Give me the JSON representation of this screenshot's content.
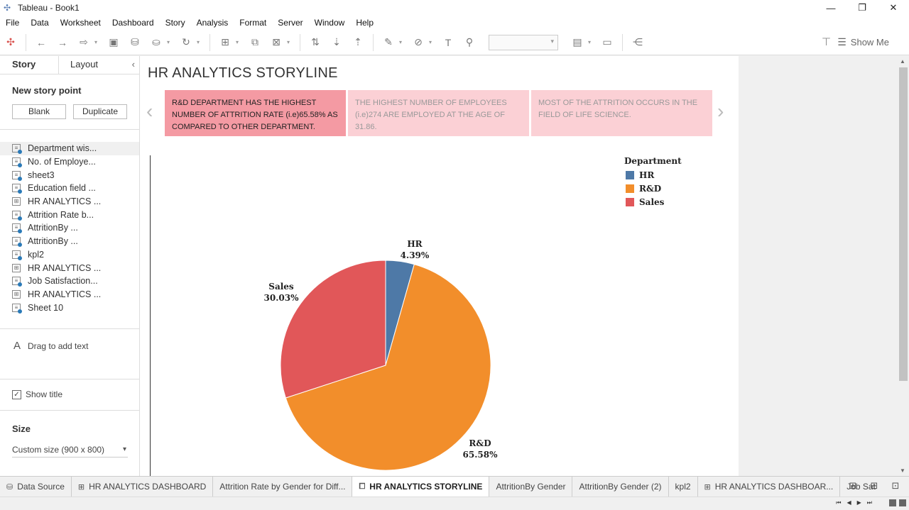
{
  "window": {
    "title": "Tableau - Book1"
  },
  "menu": [
    "File",
    "Data",
    "Worksheet",
    "Dashboard",
    "Story",
    "Analysis",
    "Format",
    "Server",
    "Window",
    "Help"
  ],
  "toolbar": {
    "show_me": "Show Me"
  },
  "sidebar": {
    "tab_story": "Story",
    "tab_layout": "Layout",
    "new_story_point": "New story point",
    "blank_label": "Blank",
    "duplicate_label": "Duplicate",
    "sheets": [
      {
        "label": "Department wis...",
        "type": "sheet"
      },
      {
        "label": "No. of Employe...",
        "type": "sheet"
      },
      {
        "label": "sheet3",
        "type": "sheet"
      },
      {
        "label": "Education field ...",
        "type": "sheet"
      },
      {
        "label": "HR ANALYTICS ...",
        "type": "dashboard"
      },
      {
        "label": "Attrition Rate b...",
        "type": "sheet"
      },
      {
        "label": "AttritionBy ...",
        "type": "sheet"
      },
      {
        "label": "AttritionBy ...",
        "type": "sheet"
      },
      {
        "label": "kpl2",
        "type": "sheet"
      },
      {
        "label": "HR ANALYTICS ...",
        "type": "dashboard"
      },
      {
        "label": "Job Satisfaction...",
        "type": "sheet"
      },
      {
        "label": "HR ANALYTICS ...",
        "type": "dashboard"
      },
      {
        "label": "Sheet 10",
        "type": "sheet"
      }
    ],
    "drag_text": "Drag to add text",
    "show_title": "Show title",
    "size_heading": "Size",
    "size_value": "Custom size (900 x 800)"
  },
  "story": {
    "title": "HR ANALYTICS STORYLINE",
    "points": [
      "R&D DEPARTMENT HAS THE HIGHEST NUMBER OF  ATTRITION RATE  (i.e)65.58% AS COMPARED TO OTHER DEPARTMENT.",
      "THE HIGHEST NUMBER OF EMPLOYEES (i.e)274 ARE EMPLOYED AT THE AGE OF 31.86.",
      "MOST OF THE ATTRITION OCCURS IN THE FIELD OF LIFE SCIENCE."
    ]
  },
  "chart_data": {
    "type": "pie",
    "legend_title": "Department",
    "legend_position": "top-right",
    "slices": [
      {
        "name": "HR",
        "value": 4.39,
        "label": "4.39%",
        "color": "#4e79a7"
      },
      {
        "name": "R&D",
        "value": 65.58,
        "label": "65.58%",
        "color": "#f28e2b"
      },
      {
        "name": "Sales",
        "value": 30.03,
        "label": "30.03%",
        "color": "#e15759"
      }
    ]
  },
  "bottom_tabs": [
    {
      "label": "Data Source",
      "icon": "database-icon",
      "active": false
    },
    {
      "label": "HR ANALYTICS DASHBOARD",
      "icon": "dashboard-icon",
      "active": false
    },
    {
      "label": "Attrition Rate by Gender for Diff...",
      "icon": "",
      "active": false
    },
    {
      "label": "HR ANALYTICS STORYLINE",
      "icon": "story-icon",
      "active": true
    },
    {
      "label": "AttritionBy Gender",
      "icon": "",
      "active": false
    },
    {
      "label": "AttritionBy Gender (2)",
      "icon": "",
      "active": false
    },
    {
      "label": "kpl2",
      "icon": "",
      "active": false
    },
    {
      "label": "HR ANALYTICS DASHBOAR...",
      "icon": "dashboard-icon",
      "active": false
    },
    {
      "label": "Job Sat",
      "icon": "",
      "active": false
    }
  ]
}
